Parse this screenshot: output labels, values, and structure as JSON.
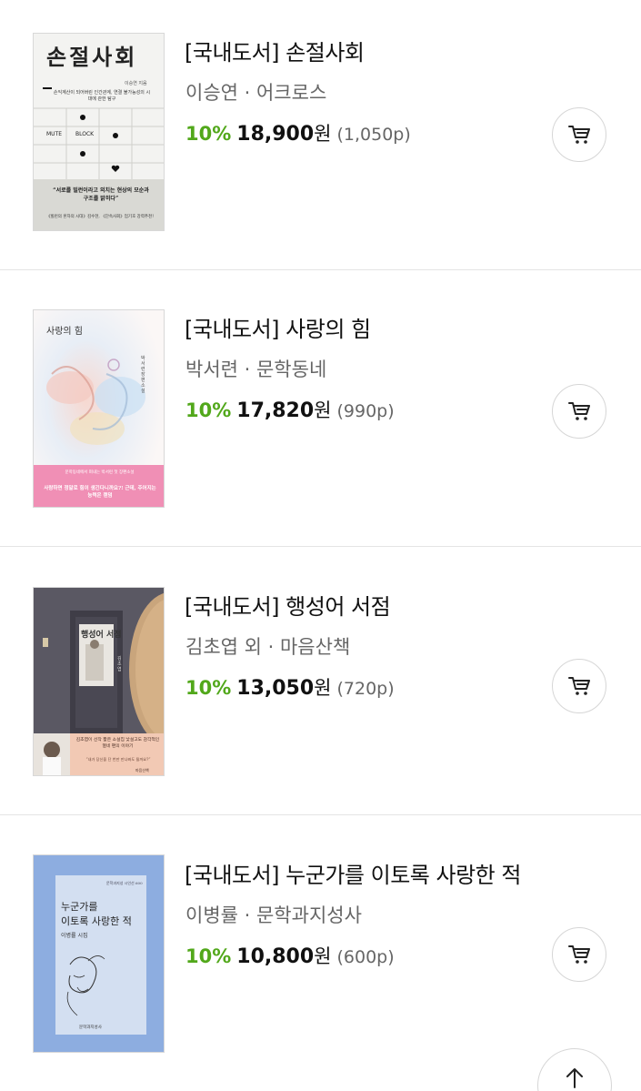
{
  "books": [
    {
      "title": "[국내도서] 손절사회",
      "author": "이승연 · 어크로스",
      "discount": "10%",
      "price": "18,900",
      "currency": "원",
      "pages": "(1,050p)",
      "cover": {
        "title": "손절사회",
        "subtitle": "손익계산이 되어버린 인간관계, 연결 불가능성의 시대에 관한 탐구",
        "author": "이승연 지음",
        "keys": [
          "MUTE",
          "BLOCK"
        ],
        "quote": "“서로를 빌런이라고 외치는 현상의 모순과 구조를 밝히다”",
        "recommend": "《빌런의 혼자의 시대》김수현, 《단속사회》엄기호 강력추천!"
      }
    },
    {
      "title": "[국내도서] 사랑의 힘",
      "author": "박서련 · 문학동네",
      "discount": "10%",
      "price": "17,820",
      "currency": "원",
      "pages": "(990p)",
      "cover": {
        "title": "사랑의 힘",
        "side": "박서련 장편소설",
        "band1": "문학동네에서 펴내는 박서련 첫 장편소설",
        "band2": "사랑하면 정말로 힘이 생긴다니까요?! 근데, 주어지는 능력은 랜덤"
      }
    },
    {
      "title": "[국내도서] 행성어 서점",
      "author": "김초엽 외 · 마음산책",
      "discount": "10%",
      "price": "13,050",
      "currency": "원",
      "pages": "(720p)",
      "cover": {
        "title": "행성어 서점",
        "author": "김초엽",
        "band": "김초엽이 선작 짧은 소설집 낯설고도 감각적인 열네 편의 이야기",
        "quote": "“내가 당신을 단 번만 만나봐도 될까요?”",
        "publisher": "마음산책"
      }
    },
    {
      "title": "[국내도서] 누군가를 이토록 사랑한 적",
      "author": "이병률 · 문학과지성사",
      "discount": "10%",
      "price": "10,800",
      "currency": "원",
      "pages": "(600p)",
      "cover": {
        "series": "문학과지성 시인선 600",
        "title_line1": "누군가를",
        "title_line2": "이토록 사랑한 적",
        "author": "이병률 시집",
        "publisher": "문학과지성사"
      }
    }
  ],
  "icons": {
    "cart": "cart-icon",
    "scroll_top": "arrow-up-icon"
  },
  "colors": {
    "discount": "#52a81b",
    "text_primary": "#111111",
    "text_secondary": "#666666",
    "divider": "#e4e4e4"
  }
}
